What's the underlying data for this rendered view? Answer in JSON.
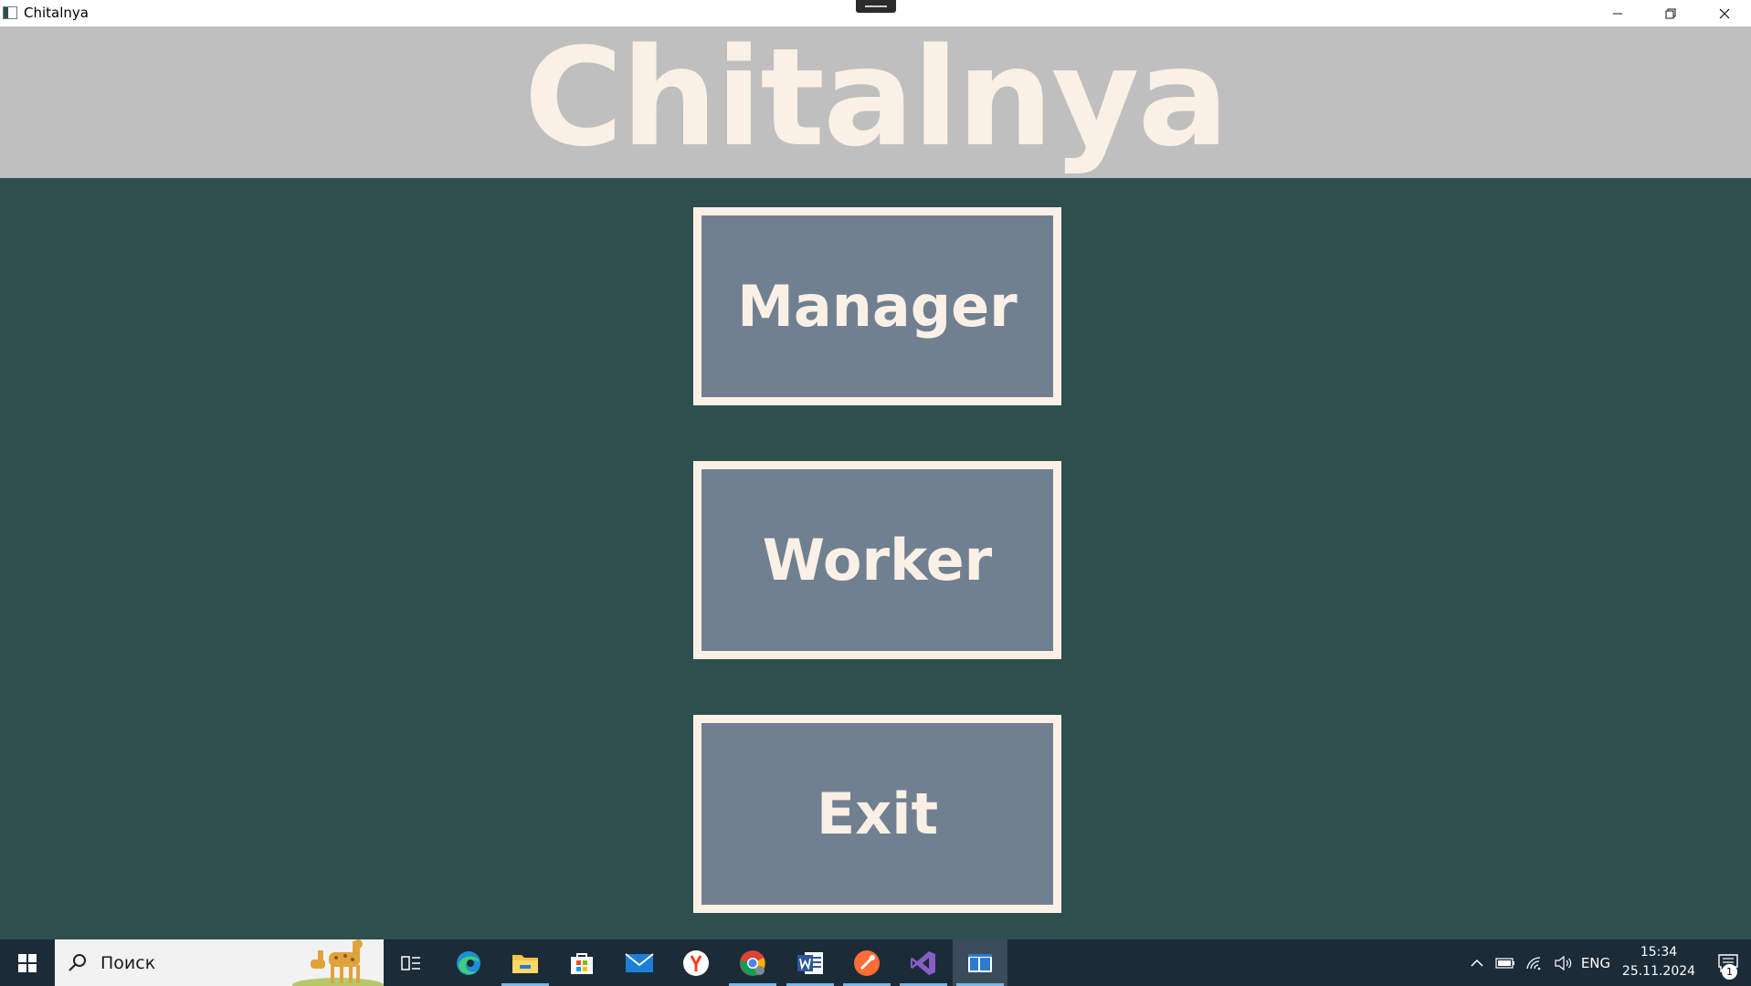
{
  "window": {
    "title": "Chitalnya",
    "controls": {
      "minimize": "minimize-icon",
      "maximize": "restore-icon",
      "close": "close-icon"
    }
  },
  "header": {
    "title": "Chitalnya"
  },
  "menu": {
    "buttons": [
      {
        "label": "Manager"
      },
      {
        "label": "Worker"
      },
      {
        "label": "Exit"
      }
    ]
  },
  "taskbar": {
    "search_placeholder": "Поиск",
    "pinned_apps": [
      "task-view-icon",
      "edge-icon",
      "file-explorer-icon",
      "microsoft-store-icon",
      "mail-icon",
      "yandex-browser-icon",
      "chrome-icon",
      "word-icon",
      "postman-icon",
      "visual-studio-icon",
      "chitalnya-app-icon"
    ],
    "tray": {
      "language": "ENG",
      "time": "15:34",
      "date": "25.11.2024",
      "notification_count": "1"
    }
  },
  "colors": {
    "background": "#2F4F4F",
    "header_bg": "#BFBFBF",
    "accent_text": "#FAF0E6",
    "button_bg": "#708090",
    "taskbar_bg": "#1B2B38"
  }
}
